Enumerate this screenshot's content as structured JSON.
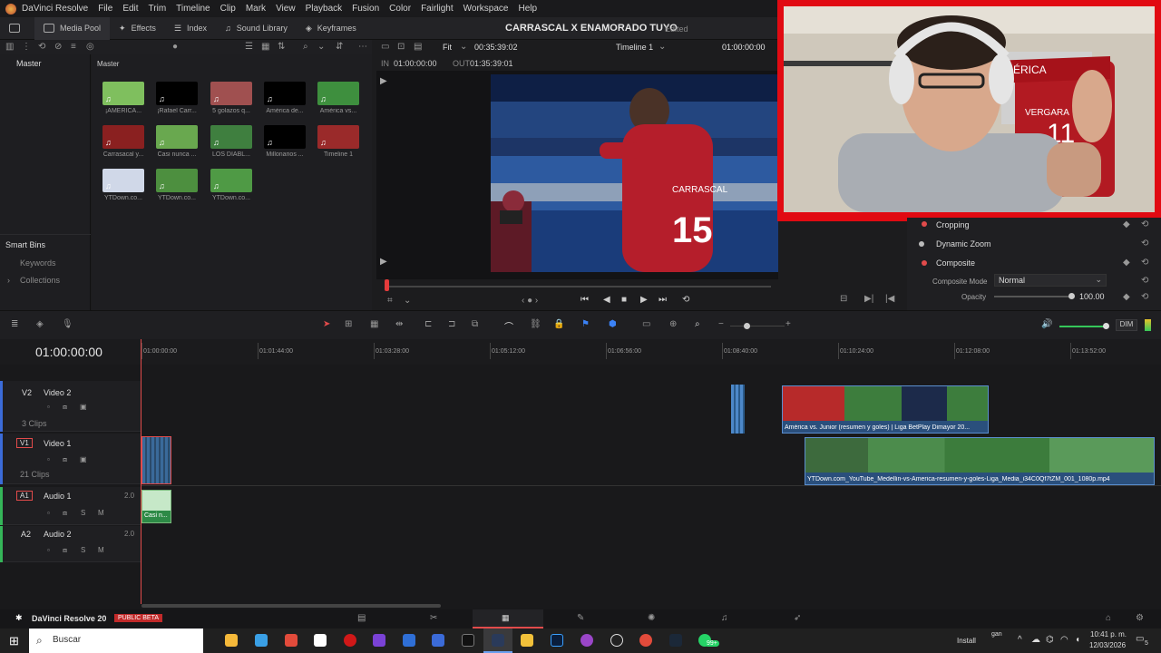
{
  "menu": [
    "DaVinci Resolve",
    "File",
    "Edit",
    "Trim",
    "Timeline",
    "Clip",
    "Mark",
    "View",
    "Playback",
    "Fusion",
    "Color",
    "Fairlight",
    "Workspace",
    "Help"
  ],
  "toolbar": {
    "media_pool": "Media Pool",
    "effects": "Effects",
    "index": "Index",
    "sound_library": "Sound Library",
    "keyframes": "Keyframes",
    "project_title": "CARRASCAL X ENAMORADO TUYO",
    "edited": "Edited"
  },
  "viewer": {
    "fit": "Fit",
    "duration": "00:35:39:02",
    "timeline_name": "Timeline 1",
    "timecode": "01:00:00:00",
    "in_label": "IN",
    "in_tc": "01:00:00:00",
    "out_label": "OUT",
    "out_tc": "01:35:39:01"
  },
  "left_panel": {
    "master": "Master",
    "smart_bins": "Smart Bins",
    "keywords": "Keywords",
    "collections": "Collections"
  },
  "pool": {
    "header": "Master",
    "clips": [
      {
        "label": "¡AMÉRICA...",
        "color": "#7fbf5e"
      },
      {
        "label": "¡Rafael Carr...",
        "color": "#000000"
      },
      {
        "label": "5 golazos q...",
        "color": "#a05050"
      },
      {
        "label": "América de...",
        "color": "#000000"
      },
      {
        "label": "América vs...",
        "color": "#3e8f3e"
      },
      {
        "label": "Carrasacal y...",
        "color": "#8a2020"
      },
      {
        "label": "Casi nunca ...",
        "color": "#69a84f"
      },
      {
        "label": "LOS DIABL...",
        "color": "#3f7f3f"
      },
      {
        "label": "Millonarios ...",
        "color": "#000000"
      },
      {
        "label": "Timeline 1",
        "color": "#9a2a2a"
      },
      {
        "label": "YTDown.co...",
        "color": "#d0d8e8"
      },
      {
        "label": "YTDown.co...",
        "color": "#4d8f3f"
      },
      {
        "label": "YTDown.co...",
        "color": "#4f9a45"
      }
    ]
  },
  "inspector": {
    "cropping": "Cropping",
    "dynamic_zoom": "Dynamic Zoom",
    "composite": "Composite",
    "composite_mode_label": "Composite Mode",
    "composite_mode_value": "Normal",
    "opacity_label": "Opacity",
    "opacity_value": "100.00"
  },
  "timeline": {
    "current_tc": "01:00:00:00",
    "ruler": [
      "01:00:00:00",
      "01:01:44:00",
      "01:03:28:00",
      "01:05:12:00",
      "01:06:56:00",
      "01:08:40:00",
      "01:10:24:00",
      "01:12:08:00",
      "01:13:52:00"
    ],
    "dim": "DIM",
    "tracks": {
      "v2": {
        "tag": "V2",
        "name": "Video 2",
        "clips": "3 Clips"
      },
      "v1": {
        "tag": "V1",
        "name": "Video 1",
        "clips": "21 Clips"
      },
      "a1": {
        "tag": "A1",
        "name": "Audio 1",
        "level": "2.0"
      },
      "a2": {
        "tag": "A2",
        "name": "Audio 2",
        "level": "2.0"
      }
    },
    "clip_v2_label": "América vs. Junior (resumen y goles)  |  Liga BetPlay Dimayor 20...",
    "clip_v1_label": "YTDown.com_YouTube_Medellin-vs-America-resumen-y-goles-Liga_Media_i34C0Qf7tZM_001_1080p.mp4",
    "clip_a1_label": "Casi n..."
  },
  "bottom": {
    "app_name": "DaVinci Resolve 20",
    "beta": "PUBLIC BETA"
  },
  "taskbar": {
    "search": "Buscar",
    "install": "Install",
    "gan": "gan",
    "time": "10:41 p. m.",
    "date": "12/03/2026",
    "badge": "99+",
    "notif": "5"
  }
}
